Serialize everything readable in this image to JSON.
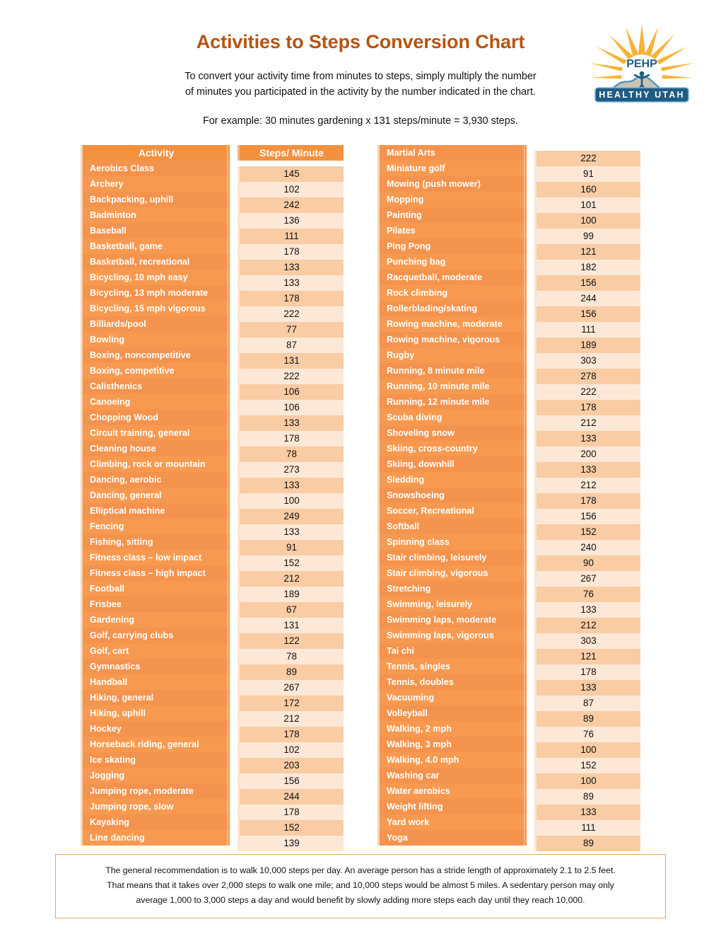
{
  "header": {
    "title": "Activities to Steps Conversion Chart",
    "intro_line1": "To convert your activity time from minutes to steps, simply multiply the number",
    "intro_line2": "of minutes you participated in the activity by the number indicated in the chart.",
    "example": "For example:  30 minutes gardening x 131 steps/minute = 3,930 steps."
  },
  "logo": {
    "brand": "PEHP",
    "banner": "HEALTHY UTAH",
    "sun_color": "#F7B337",
    "banner_color": "#1F5C84",
    "mountain_color": "#C9C3B4"
  },
  "table": {
    "header_activity": "Activity",
    "header_steps": "Steps/ Minute",
    "accent": "#F4913F",
    "steps_band_dark": "#F9CCA4",
    "steps_band_light": "#FDE7D7"
  },
  "chart_data": {
    "type": "table",
    "title": "Activities to Steps Conversion Chart",
    "columns": [
      "Activity",
      "Steps/ Minute"
    ],
    "left": [
      {
        "activity": "Aerobics Class",
        "steps": 145
      },
      {
        "activity": "Archery",
        "steps": 102
      },
      {
        "activity": "Backpacking, uphill",
        "steps": 242
      },
      {
        "activity": "Badminton",
        "steps": 136
      },
      {
        "activity": "Baseball",
        "steps": 111
      },
      {
        "activity": "Basketball, game",
        "steps": 178
      },
      {
        "activity": "Basketball, recreational",
        "steps": 133
      },
      {
        "activity": "Bicycling, 10 mph easy",
        "steps": 133
      },
      {
        "activity": "Bicycling, 13 mph moderate",
        "steps": 178
      },
      {
        "activity": "Bicycling, 15 mph vigorous",
        "steps": 222
      },
      {
        "activity": "Billiards/pool",
        "steps": 77
      },
      {
        "activity": "Bowling",
        "steps": 87
      },
      {
        "activity": "Boxing, noncompetitive",
        "steps": 131
      },
      {
        "activity": "Boxing, competitive",
        "steps": 222
      },
      {
        "activity": "Calisthenics",
        "steps": 106
      },
      {
        "activity": "Canoeing",
        "steps": 106
      },
      {
        "activity": "Chopping Wood",
        "steps": 133
      },
      {
        "activity": "Circuit training, general",
        "steps": 178
      },
      {
        "activity": "Cleaning house",
        "steps": 78
      },
      {
        "activity": "Climbing, rock or mountain",
        "steps": 273
      },
      {
        "activity": "Dancing, aerobic",
        "steps": 133
      },
      {
        "activity": "Dancing, general",
        "steps": 100
      },
      {
        "activity": "Elliptical machine",
        "steps": 249
      },
      {
        "activity": "Fencing",
        "steps": 133
      },
      {
        "activity": "Fishing, sitting",
        "steps": 91
      },
      {
        "activity": "Fitness class – low impact",
        "steps": 152
      },
      {
        "activity": "Fitness class – high impact",
        "steps": 212
      },
      {
        "activity": "Football",
        "steps": 189
      },
      {
        "activity": "Frisbee",
        "steps": 67
      },
      {
        "activity": "Gardening",
        "steps": 131
      },
      {
        "activity": "Golf, carrying clubs",
        "steps": 122
      },
      {
        "activity": "Golf, cart",
        "steps": 78
      },
      {
        "activity": "Gymnastics",
        "steps": 89
      },
      {
        "activity": "Handball",
        "steps": 267
      },
      {
        "activity": "Hiking, general",
        "steps": 172
      },
      {
        "activity": "Hiking, uphill",
        "steps": 212
      },
      {
        "activity": "Hockey",
        "steps": 178
      },
      {
        "activity": "Horseback riding, general",
        "steps": 102
      },
      {
        "activity": "Ice skating",
        "steps": 203
      },
      {
        "activity": "Jogging",
        "steps": 156
      },
      {
        "activity": "Jumping rope, moderate",
        "steps": 244
      },
      {
        "activity": "Jumping rope, slow",
        "steps": 178
      },
      {
        "activity": "Kayaking",
        "steps": 152
      },
      {
        "activity": "Line dancing",
        "steps": 139
      }
    ],
    "right": [
      {
        "activity": "Martial Arts",
        "steps": 222
      },
      {
        "activity": "Miniature golf",
        "steps": 91
      },
      {
        "activity": "Mowing (push mower)",
        "steps": 160
      },
      {
        "activity": "Mopping",
        "steps": 101
      },
      {
        "activity": "Painting",
        "steps": 100
      },
      {
        "activity": "Pilates",
        "steps": 99
      },
      {
        "activity": "Ping Pong",
        "steps": 121
      },
      {
        "activity": "Punching bag",
        "steps": 182
      },
      {
        "activity": "Racquetball, moderate",
        "steps": 156
      },
      {
        "activity": "Rock climbing",
        "steps": 244
      },
      {
        "activity": "Rollerblading/skating",
        "steps": 156
      },
      {
        "activity": "Rowing machine, moderate",
        "steps": 111
      },
      {
        "activity": "Rowing machine, vigorous",
        "steps": 189
      },
      {
        "activity": "Rugby",
        "steps": 303
      },
      {
        "activity": "Running, 8 minute mile",
        "steps": 278
      },
      {
        "activity": "Running, 10 minute mile",
        "steps": 222
      },
      {
        "activity": "Running, 12 minute mile",
        "steps": 178
      },
      {
        "activity": "Scuba diving",
        "steps": 212
      },
      {
        "activity": "Shoveling snow",
        "steps": 133
      },
      {
        "activity": "Skiing, cross-country",
        "steps": 200
      },
      {
        "activity": "Skiing, downhill",
        "steps": 133
      },
      {
        "activity": "Sledding",
        "steps": 212
      },
      {
        "activity": "Snowshoeing",
        "steps": 178
      },
      {
        "activity": "Soccer, Recreational",
        "steps": 156
      },
      {
        "activity": "Softball",
        "steps": 152
      },
      {
        "activity": "Spinning class",
        "steps": 240
      },
      {
        "activity": "Stair climbing, leisurely",
        "steps": 90
      },
      {
        "activity": "Stair climbing, vigorous",
        "steps": 267
      },
      {
        "activity": "Stretching",
        "steps": 76
      },
      {
        "activity": "Swimming, leisurely",
        "steps": 133
      },
      {
        "activity": "Swimming laps, moderate",
        "steps": 212
      },
      {
        "activity": "Swimming laps, vigorous",
        "steps": 303
      },
      {
        "activity": "Tai chi",
        "steps": 121
      },
      {
        "activity": "Tennis, singles",
        "steps": 178
      },
      {
        "activity": "Tennis, doubles",
        "steps": 133
      },
      {
        "activity": "Vacuuming",
        "steps": 87
      },
      {
        "activity": "Volleyball",
        "steps": 89
      },
      {
        "activity": "Walking, 2 mph",
        "steps": 76
      },
      {
        "activity": "Walking, 3 mph",
        "steps": 100
      },
      {
        "activity": "Walking, 4.0 mph",
        "steps": 152
      },
      {
        "activity": "Washing car",
        "steps": 100
      },
      {
        "activity": "Water aerobics",
        "steps": 89
      },
      {
        "activity": "Weight lifting",
        "steps": 133
      },
      {
        "activity": "Yard work",
        "steps": 111
      },
      {
        "activity": "Yoga",
        "steps": 89
      }
    ]
  },
  "footer": {
    "line1": "The general recommendation is to walk 10,000 steps per day. An average person has a stride length of approximately 2.1 to 2.5 feet.",
    "line2": "That means that it takes over 2,000 steps to walk one mile; and 10,000 steps would be almost 5 miles. A sedentary person may only",
    "line3": "average 1,000 to 3,000 steps a day and would benefit by slowly adding more steps each day until they reach 10,000."
  }
}
